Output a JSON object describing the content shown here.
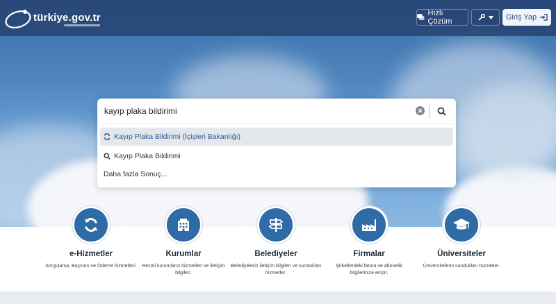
{
  "header": {
    "logo_text": "türkiye.gov.tr",
    "quick_label": "Hızlı Çözüm",
    "login_label": "Giriş Yap"
  },
  "search": {
    "value": "kayıp plaka bildirimi",
    "suggestions": [
      {
        "label": "Kayıp Plaka Bildirimi (İçişleri Bakanlığı)",
        "icon": "refresh-icon"
      },
      {
        "label": "Kayıp Plaka Bildirimi",
        "icon": "search-icon"
      },
      {
        "label": "Daha fazla Sonuç...",
        "icon": ""
      }
    ]
  },
  "categories": [
    {
      "title": "e-Hizmetler",
      "desc": "Sorgulama, Başvuru ve Ödeme hizmetleri.",
      "icon": "refresh-icon"
    },
    {
      "title": "Kurumlar",
      "desc": "Resmi kurumların hizmetleri ve iletişim bilgileri.",
      "icon": "building-icon"
    },
    {
      "title": "Belediyeler",
      "desc": "Belediyelerin iletişim bilgileri ve sundukları hizmetler.",
      "icon": "signpost-icon"
    },
    {
      "title": "Firmalar",
      "desc": "Şirketlerdeki fatura ve abonelik bilgilerinize erişin.",
      "icon": "factory-icon"
    },
    {
      "title": "Üniversiteler",
      "desc": "Üniversitelerin sundukları hizmetler.",
      "icon": "graduation-cap-icon"
    }
  ],
  "colors": {
    "primary": "#2f6ba7",
    "header": "#243e6c",
    "link": "#2d5a92"
  }
}
